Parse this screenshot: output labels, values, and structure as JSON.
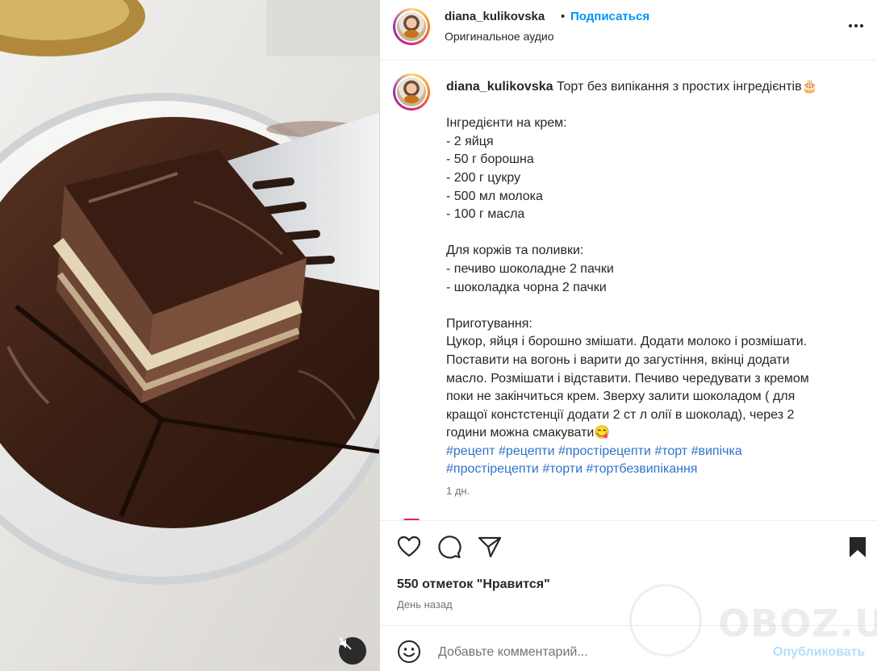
{
  "header": {
    "username": "diana_kulikovska",
    "separator": "•",
    "follow_label": "Подписаться",
    "audio_label": "Оригинальное аудио"
  },
  "caption": {
    "username": "diana_kulikovska",
    "title": "Торт без випікання з простих інгредієнтів🎂",
    "cream_heading": "Інгредієнти на крем:",
    "cream_items": [
      "- 2 яйця",
      "- 50 г борошна",
      "- 200 г цукру",
      "- 500 мл молока",
      "- 100 г масла"
    ],
    "base_heading": "Для коржів та поливки:",
    "base_items": [
      "- печиво шоколадне 2 пачки",
      "- шоколадка чорна 2 пачки"
    ],
    "method_heading": "Приготування:",
    "method_lines": [
      "Цукор, яйця і борошно змішати. Додати молоко і розмішати.",
      "Поставити на вогонь і варити до загустіння, вкінці додати",
      "масло. Розмішати і відставити. Печиво чередувати з кремом",
      "поки не закінчиться крем. Зверху залити шоколадом ( для",
      "кращої констстенції додати 2 ст л олії в шоколад), через 2",
      "години можна смакувати😋"
    ],
    "hashtags_line1": [
      "#рецепт",
      "#рецепти",
      "#простірецепти",
      "#торт",
      "#випічка"
    ],
    "hashtags_line2": [
      "#простірецепти",
      "#торти",
      "#тортбезвипікання"
    ],
    "time": "1 дн."
  },
  "actions": {
    "like_icon": "heart-icon",
    "comment_icon": "comment-icon",
    "share_icon": "paper-plane-icon",
    "save_icon": "bookmark-icon",
    "likes_text": "550 отметок \"Нравится\"",
    "date_text": "День назад"
  },
  "comment_bar": {
    "emoji_icon": "smiley-icon",
    "placeholder": "Добавьте комментарий...",
    "publish_label": "Опубликовать"
  },
  "watermark": {
    "text": "OBOZ.UA"
  },
  "media": {
    "mute_icon": "muted-speaker-icon"
  },
  "colors": {
    "accent": "#0095f6",
    "hashtag": "#2f73c8",
    "muted_text": "#737373",
    "publish_disabled": "#b2dffc"
  }
}
